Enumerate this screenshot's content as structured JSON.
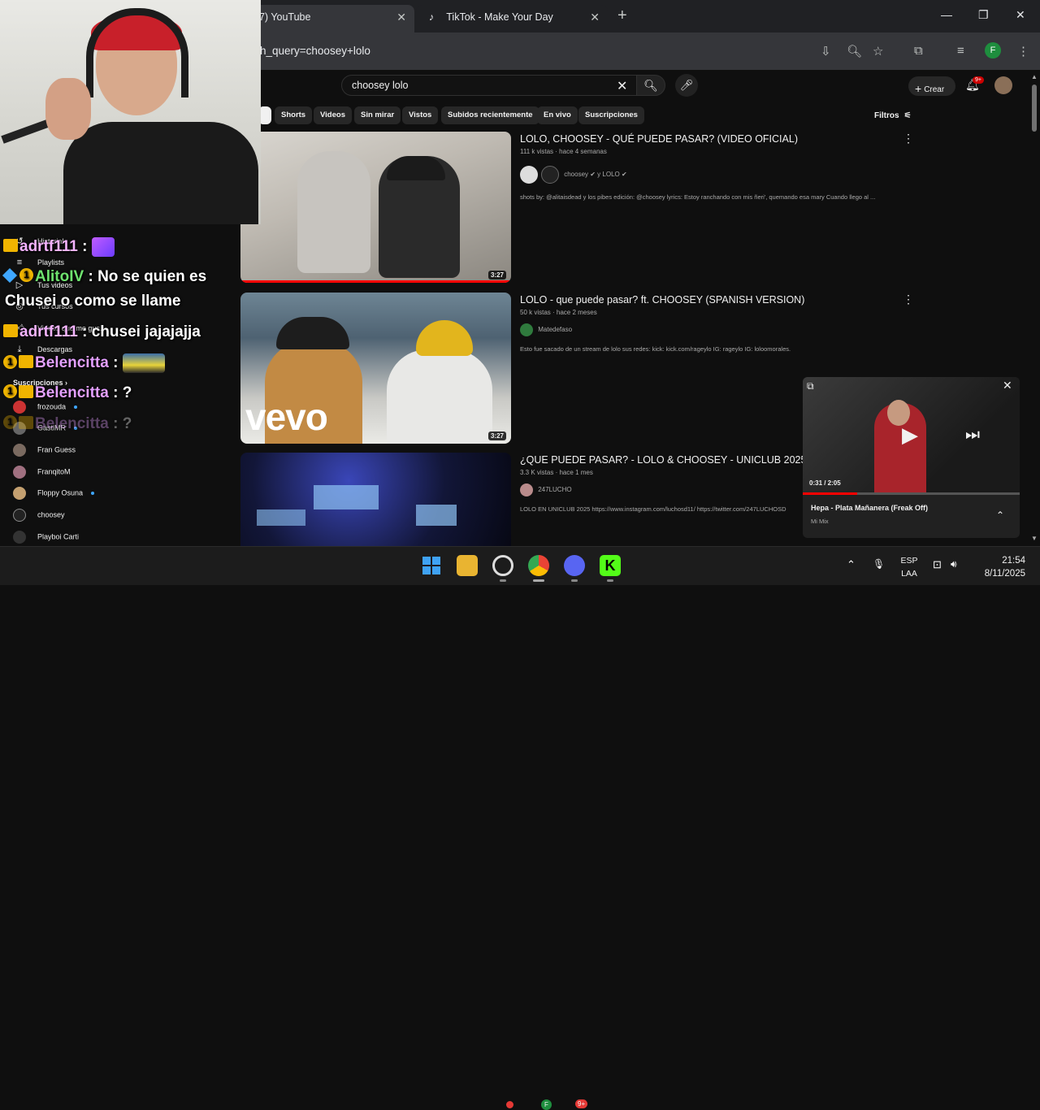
{
  "browser": {
    "tabs": [
      {
        "label": "17) YouTube",
        "active": true
      },
      {
        "label": "TikTok - Make Your Day",
        "active": false
      }
    ],
    "close_glyph": "✕",
    "new_tab_glyph": "+",
    "url": "h_query=choosey+lolo",
    "profile_initial": "F",
    "tiktok_logo": "♪",
    "window_controls": {
      "minimize": "—",
      "restore": "❐",
      "close": "✕"
    },
    "toolbar_icons": {
      "install": "⇩",
      "zoom": "🔍︎",
      "bookmark": "☆",
      "extensions": "⧉",
      "media": "≡",
      "menu": "⋮"
    }
  },
  "youtube": {
    "search": {
      "query": "choosey lolo",
      "clear_glyph": "✕",
      "search_glyph": "🔍︎",
      "mic_glyph": "🎤︎"
    },
    "create_label": "Crear",
    "create_glyph": "+",
    "bell_glyph": "🔔︎",
    "notifications_badge": "9+",
    "chips": [
      "Shorts",
      "Videos",
      "Sin mirar",
      "Vistos",
      "Subidos recientemente",
      "En vivo",
      "Suscripciones"
    ],
    "filters_label": "Filtros",
    "filters_glyph": "⚟",
    "more_glyph": "⋮",
    "results": [
      {
        "title": "LOLO, CHOOSEY - QUÉ PUEDE PASAR? (VIDEO OFICIAL)",
        "meta": "111 k vistas · hace 4 semanas",
        "channel": "choosey ✔ y LOLO ✔",
        "description": "shots by: @alitaisdead y los pibes edición: @choosey lyrics: Estoy ranchando con mis ñeri', quemando esa mary Cuando llego al ...",
        "duration": "3:27",
        "watched": true
      },
      {
        "title": "LOLO - que puede pasar? ft. CHOOSEY (SPANISH VERSION)",
        "meta": "50 k vistas · hace 2 meses",
        "channel": "Matedefaso",
        "description": "Esto fue sacado de un stream de lolo sus redes: kick: kick.com/rageylo IG: rageylo IG: loloomorales.",
        "duration": "3:27",
        "thumb_text": "vevo",
        "watched": false
      },
      {
        "title": "¿QUE PUEDE PASAR? - LOLO & CHOOSEY - UNICLUB 2025",
        "meta": "3.3 K vistas · hace 1 mes",
        "channel": "247LUCHO",
        "description": "LOLO EN UNICLUB 2025 https://www.instagram.com/luchosd11/ https://twitter.com/247LUCHOSD",
        "duration": "",
        "watched": false
      }
    ],
    "sidebar": {
      "items": [
        {
          "label": "Historial",
          "glyph": "↺"
        },
        {
          "label": "Playlists",
          "glyph": "≡"
        },
        {
          "label": "Tus videos",
          "glyph": "▷"
        },
        {
          "label": "Tus cursos",
          "glyph": "◎"
        },
        {
          "label": "Videos que me gus...",
          "glyph": "👍︎"
        },
        {
          "label": "Descargas",
          "glyph": "⤓"
        }
      ],
      "subscriptions_label": "Suscripciones  ›",
      "subscriptions": [
        {
          "label": "frozouda",
          "live": true
        },
        {
          "label": "GastiMR",
          "live": true
        },
        {
          "label": "Fran Guess",
          "live": false
        },
        {
          "label": "FranqitoM",
          "live": false
        },
        {
          "label": "Floppy Osuna",
          "live": true
        },
        {
          "label": "choosey",
          "live": false
        },
        {
          "label": "Playboi Carti",
          "live": false
        }
      ]
    },
    "miniplayer": {
      "time": "0:31 / 2:05",
      "progress": 0.25,
      "title": "Hepa - Plata Mañanera (Freak Off)",
      "subtitle": "Mi Mix",
      "play_glyph": "▶",
      "next_glyph": "⏭",
      "close_glyph": "✕",
      "expand_glyph": "⧉",
      "chevron_glyph": "⌃"
    }
  },
  "chat": {
    "messages": [
      {
        "user": "adrtf111",
        "sep": " : ",
        "text": "",
        "badges": [
          "crown"
        ],
        "color": "#f4b3ff",
        "emote": "purple"
      },
      {
        "user": "AlitoIV",
        "sep": " : ",
        "text": "No se quien es",
        "badges": [
          "cube",
          "one"
        ],
        "color": "#6fe36f"
      },
      {
        "user": "",
        "sep": "",
        "text": "Chusei o como se llame",
        "badges": [],
        "color": "#ffffff"
      },
      {
        "user": "adrtf111",
        "sep": " : ",
        "text": "chusei jajajajja",
        "badges": [
          "crown"
        ],
        "color": "#f4b3ff"
      },
      {
        "user": "Belencitta",
        "sep": " : ",
        "text": "",
        "badges": [
          "one",
          "crown"
        ],
        "color": "#e39fff",
        "emote": "minion"
      },
      {
        "user": "Belencitta",
        "sep": " : ",
        "text": "?",
        "badges": [
          "one",
          "crown"
        ],
        "color": "#e39fff"
      },
      {
        "user": "Belencitta",
        "sep": " : ",
        "text": "?",
        "badges": [
          "one",
          "crown"
        ],
        "color": "#e39fff",
        "fading": true
      }
    ]
  },
  "taskbar": {
    "apps": [
      "start",
      "explorer",
      "obs",
      "chrome",
      "discord",
      "kick"
    ],
    "discord_badge": "9+",
    "chrome_profile": "F",
    "language": "ESP",
    "layout": "LAA",
    "time": "21:54",
    "date": "8/11/2025",
    "tray_glyphs": {
      "chevron": "⌃",
      "mic": "🎙︎",
      "network": "⊡",
      "volume": "🔊︎"
    }
  },
  "colors": {
    "accent_red": "#ff0000",
    "background": "#0f0f0f",
    "chip_bg": "#272727",
    "link_blue": "#3ea6ff"
  }
}
